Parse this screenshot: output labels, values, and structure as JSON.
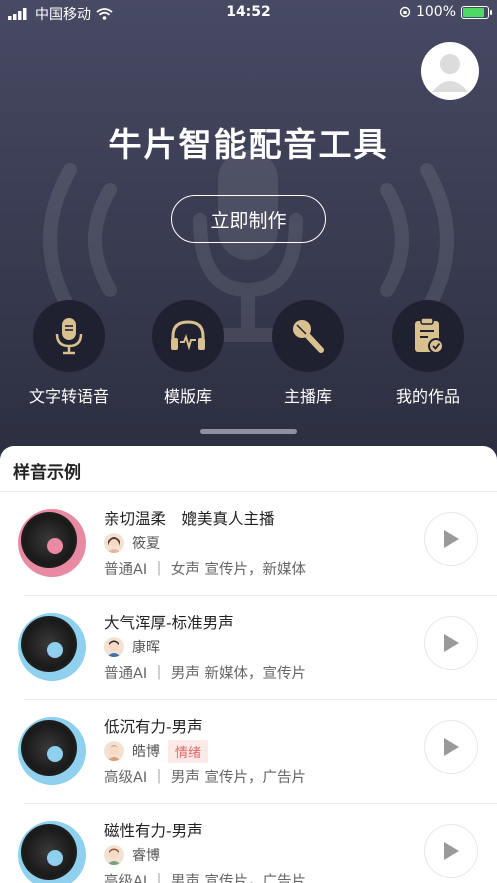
{
  "status_bar": {
    "carrier": "中国移动",
    "time": "14:52",
    "battery_percent": "100%"
  },
  "header": {
    "title": "牛片智能配音工具",
    "cta_label": "立即制作"
  },
  "features": [
    {
      "label": "文字转语音",
      "icon": "microphone-icon"
    },
    {
      "label": "模版库",
      "icon": "headphones-icon"
    },
    {
      "label": "主播库",
      "icon": "karaoke-mic-icon"
    },
    {
      "label": "我的作品",
      "icon": "clipboard-icon"
    }
  ],
  "samples": {
    "title": "样音示例",
    "items": [
      {
        "title": "亲切温柔　媲美真人主播",
        "author": "筱夏",
        "tag": "",
        "meta": "普通AI ｜ 女声  宣传片，新媒体",
        "accent": "#e98aa3"
      },
      {
        "title": "大气浑厚-标准男声",
        "author": "康晖",
        "tag": "",
        "meta": "普通AI ｜ 男声  新媒体，宣传片",
        "accent": "#8fd0ef"
      },
      {
        "title": "低沉有力-男声",
        "author": "皓博",
        "tag": "情绪",
        "meta": "高级AI ｜ 男声  宣传片，广告片",
        "accent": "#8fd0ef"
      },
      {
        "title": "磁性有力-男声",
        "author": "睿博",
        "tag": "",
        "meta": "高级AI ｜ 男声  宣传片，广告片",
        "accent": "#8fd0ef"
      }
    ]
  },
  "colors": {
    "hero_top": "#474a63",
    "hero_bottom": "#2c2e40",
    "icon_gold": "#d8c08f",
    "tag_red": "#e06a62"
  }
}
